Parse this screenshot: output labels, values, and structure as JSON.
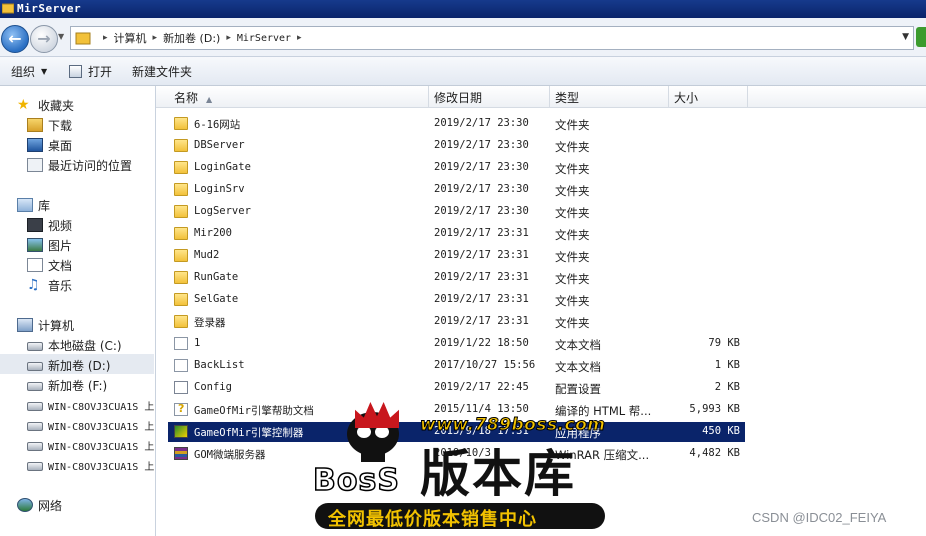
{
  "window": {
    "title": "MirServer"
  },
  "address": {
    "crumbs": [
      "计算机",
      "新加卷 (D:)",
      "MirServer"
    ]
  },
  "toolbar": {
    "organize": "组织",
    "open": "打开",
    "new_folder": "新建文件夹"
  },
  "nav": {
    "favorites": "收藏夹",
    "downloads": "下载",
    "desktop": "桌面",
    "recent": "最近访问的位置",
    "libraries": "库",
    "videos": "视频",
    "pictures": "图片",
    "documents": "文档",
    "music": "音乐",
    "computer": "计算机",
    "drive_c": "本地磁盘 (C:)",
    "drive_d": "新加卷 (D:)",
    "drive_f": "新加卷 (F:)",
    "net_drives": [
      "WIN-C8OVJ3CUA1S 上",
      "WIN-C8OVJ3CUA1S 上",
      "WIN-C8OVJ3CUA1S 上",
      "WIN-C8OVJ3CUA1S 上"
    ],
    "network": "网络"
  },
  "columns": {
    "name": "名称",
    "modified": "修改日期",
    "type": "类型",
    "size": "大小"
  },
  "files": [
    {
      "name": "6-16网站",
      "date": "2019/2/17 23:30",
      "type": "文件夹",
      "size": "",
      "icon": "folder-icon"
    },
    {
      "name": "DBServer",
      "date": "2019/2/17 23:30",
      "type": "文件夹",
      "size": "",
      "icon": "folder-icon"
    },
    {
      "name": "LoginGate",
      "date": "2019/2/17 23:30",
      "type": "文件夹",
      "size": "",
      "icon": "folder-icon"
    },
    {
      "name": "LoginSrv",
      "date": "2019/2/17 23:30",
      "type": "文件夹",
      "size": "",
      "icon": "folder-icon"
    },
    {
      "name": "LogServer",
      "date": "2019/2/17 23:30",
      "type": "文件夹",
      "size": "",
      "icon": "folder-icon"
    },
    {
      "name": "Mir200",
      "date": "2019/2/17 23:31",
      "type": "文件夹",
      "size": "",
      "icon": "folder-icon"
    },
    {
      "name": "Mud2",
      "date": "2019/2/17 23:31",
      "type": "文件夹",
      "size": "",
      "icon": "folder-icon"
    },
    {
      "name": "RunGate",
      "date": "2019/2/17 23:31",
      "type": "文件夹",
      "size": "",
      "icon": "folder-icon"
    },
    {
      "name": "SelGate",
      "date": "2019/2/17 23:31",
      "type": "文件夹",
      "size": "",
      "icon": "folder-icon"
    },
    {
      "name": "登录器",
      "date": "2019/2/17 23:31",
      "type": "文件夹",
      "size": "",
      "icon": "folder-icon"
    },
    {
      "name": "1",
      "date": "2019/1/22 18:50",
      "type": "文本文档",
      "size": "79 KB",
      "icon": "text-document-icon"
    },
    {
      "name": "BackList",
      "date": "2017/10/27 15:56",
      "type": "文本文档",
      "size": "1 KB",
      "icon": "text-document-icon"
    },
    {
      "name": "Config",
      "date": "2019/2/17 22:45",
      "type": "配置设置",
      "size": "2 KB",
      "icon": "config-file-icon"
    },
    {
      "name": "GameOfMir引擎帮助文档",
      "date": "2015/11/4 13:50",
      "type": "编译的 HTML 帮...",
      "size": "5,993 KB",
      "icon": "help-file-icon"
    },
    {
      "name": "GameOfMir引擎控制器",
      "date": "2015/9/18 17:31",
      "type": "应用程序",
      "size": "450 KB",
      "icon": "application-icon"
    },
    {
      "name": "GOM微端服务器",
      "date": "2019/10/3",
      "type": "WinRAR 压缩文...",
      "size": "4,482 KB",
      "icon": "archive-icon"
    }
  ],
  "selected_index": 14,
  "watermark": {
    "site": "www.789boss.com",
    "brand_left": "BosS",
    "brand_big": "版本库",
    "slogan": "全网最低价版本销售中心"
  },
  "credit": "CSDN @IDC02_FEIYA",
  "colors": {
    "titlebar": "#0a246a",
    "selection": "#0a246a",
    "folder": "#f2c13a"
  }
}
